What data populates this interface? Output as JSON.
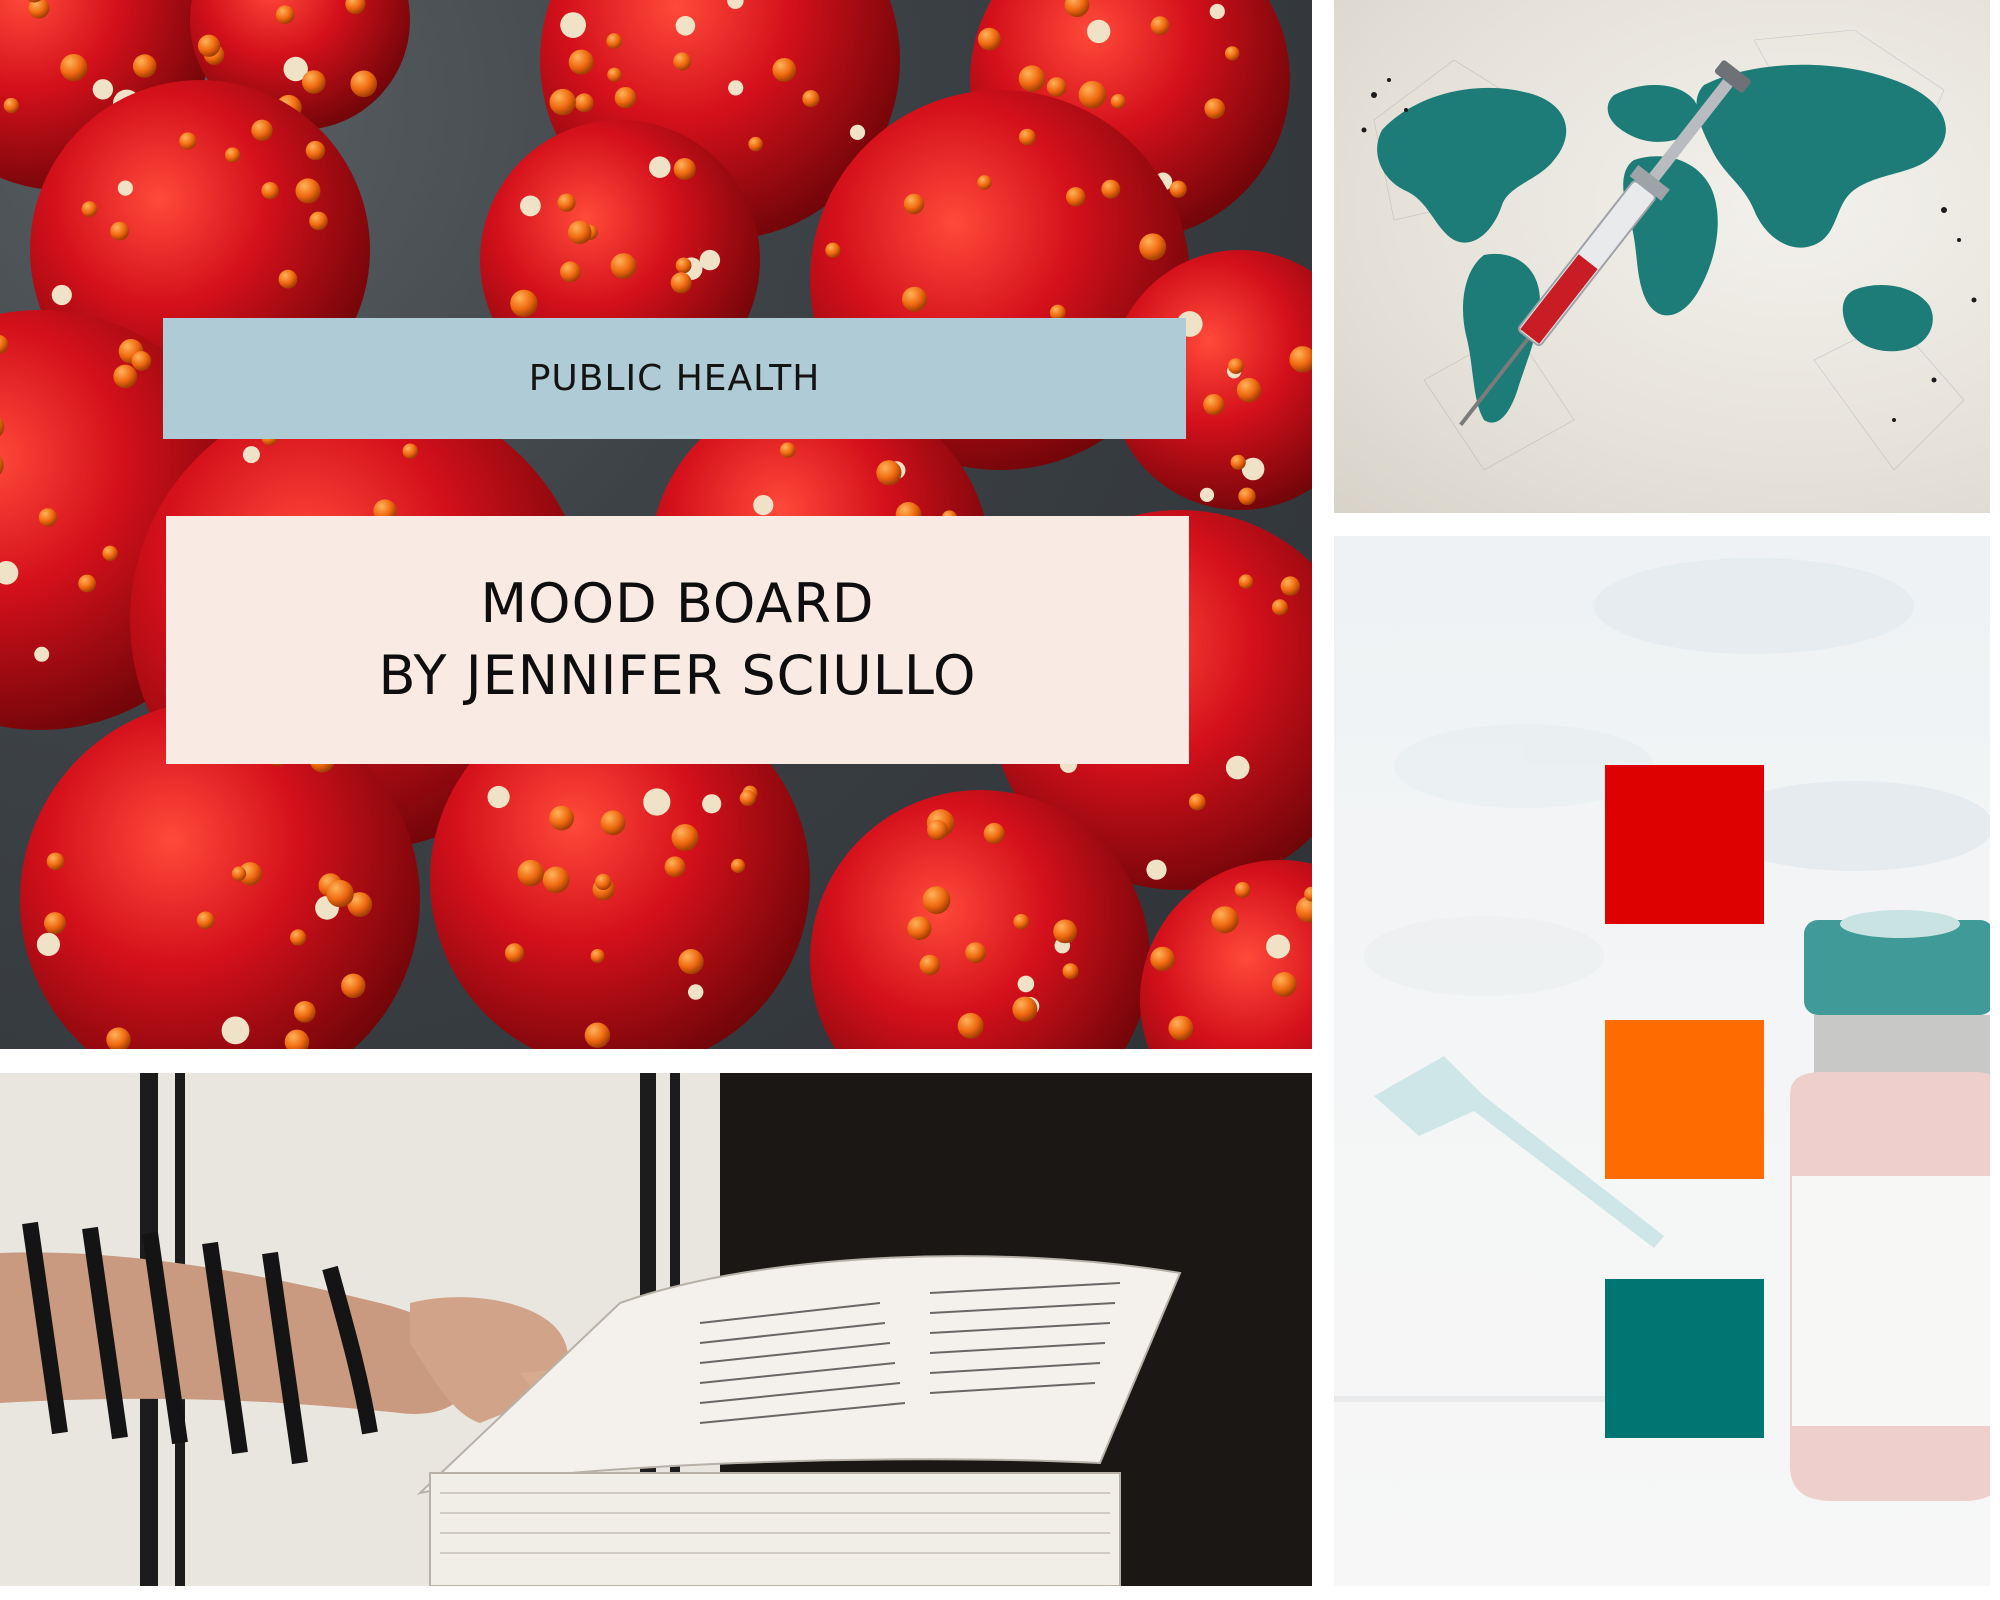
{
  "banner": {
    "tag": "PUBLIC HEALTH",
    "title_line1": "MOOD BOARD",
    "title_line2": "BY JENNIFER SCIULLO"
  },
  "images": [
    {
      "subject": "virus-particles",
      "colors": [
        "#c8101b",
        "#f06a10",
        "#2e3236"
      ]
    },
    {
      "subject": "world-map-syringe",
      "colors": [
        "#1d7b78",
        "#c81d25",
        "#ebe7e0"
      ]
    },
    {
      "subject": "vaccine-vial-pills",
      "colors": [
        "#3f9a98",
        "#f1d6d4",
        "#f4f5f6"
      ]
    },
    {
      "subject": "prayer-book-tefillin",
      "colors": [
        "#111111",
        "#f4f1ec",
        "#c99a80"
      ]
    }
  ],
  "palette": [
    {
      "name": "red",
      "hex": "#de0101"
    },
    {
      "name": "orange",
      "hex": "#fe6b00"
    },
    {
      "name": "teal",
      "hex": "#007672"
    }
  ]
}
